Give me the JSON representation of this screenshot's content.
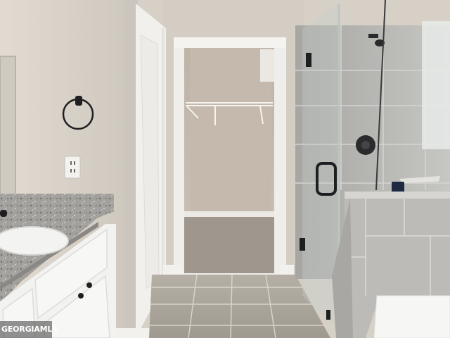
{
  "watermark": {
    "text": "GEORGIAMLS"
  },
  "icons": [
    "towel-ring-icon",
    "outlet-icon",
    "shower-head-icon",
    "shower-valve-icon",
    "door-handle-icon",
    "drawer-knob-icon"
  ],
  "colors": {
    "wall": "#d8d2c9",
    "trim": "#f2f1ee",
    "closet_wall": "#c9bfb3",
    "floor_tile": "#a9a49b",
    "shower_tile": "#b4b3af",
    "granite": "#9b9995",
    "cabinet": "#f4f4f2",
    "fixture_black": "#1f1f21"
  }
}
